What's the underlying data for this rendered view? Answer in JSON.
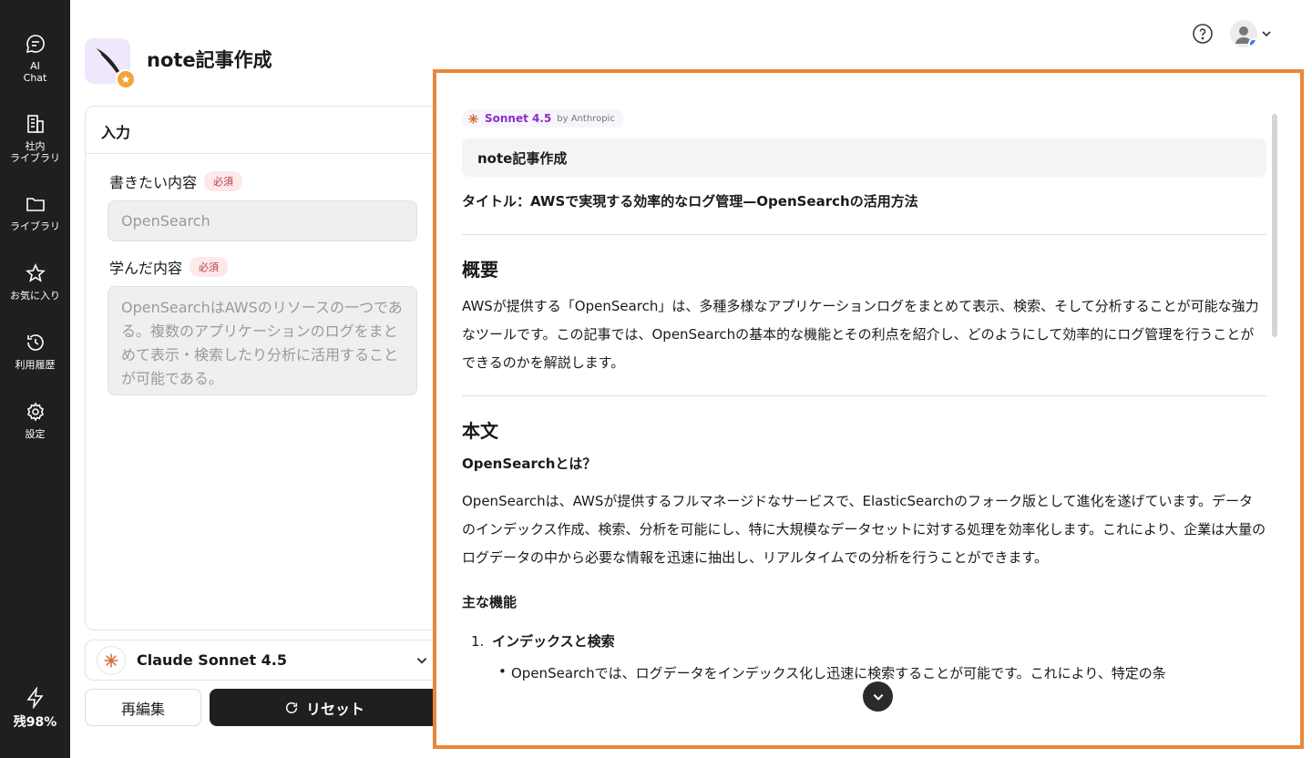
{
  "sidebar": {
    "items": [
      {
        "label": "AI\nChat",
        "icon": "chat-bubble-icon"
      },
      {
        "label": "社内\nライブラリ",
        "icon": "building-icon"
      },
      {
        "label": "ライブラリ",
        "icon": "folder-icon"
      },
      {
        "label": "お気に入り",
        "icon": "star-icon"
      },
      {
        "label": "利用履歴",
        "icon": "history-icon"
      },
      {
        "label": "設定",
        "icon": "gear-icon"
      }
    ],
    "remaining": "残98%"
  },
  "header": {
    "app_title": "note記事作成"
  },
  "input_panel": {
    "title": "入力",
    "fields": [
      {
        "label": "書きたい内容",
        "badge": "必須",
        "value": "OpenSearch"
      },
      {
        "label": "学んだ内容",
        "badge": "必須",
        "value": "OpenSearchはAWSのリソースの一つである。複数のアプリケーションのログをまとめて表示・検索したり分析に活用することが可能である。"
      }
    ],
    "model_name": "Claude Sonnet 4.5",
    "reedit_label": "再編集",
    "reset_label": "リセット"
  },
  "output": {
    "model_tag": "Sonnet 4.5",
    "model_by": "by Anthropic",
    "prompt_title": "note記事作成",
    "title_line": "タイトル：AWSで実現する効率的なログ管理—OpenSearchの活用方法",
    "section1_heading": "概要",
    "section1_text": "AWSが提供する「OpenSearch」は、多種多様なアプリケーションログをまとめて表示、検索、そして分析することが可能な強力なツールです。この記事では、OpenSearchの基本的な機能とその利点を紹介し、どのようにして効率的にログ管理を行うことができるのかを解説します。",
    "section2_heading": "本文",
    "sub_heading1": "OpenSearchとは？",
    "section2_text": "OpenSearchは、AWSが提供するフルマネージドなサービスで、ElasticSearchのフォーク版として進化を遂げています。データのインデックス作成、検索、分析を可能にし、特に大規模なデータセットに対する処理を効率化します。これにより、企業は大量のログデータの中から必要な情報を迅速に抽出し、リアルタイムでの分析を行うことができます。",
    "sub_heading2": "主な機能",
    "list_num": "1.",
    "list_item1": "インデックスと検索",
    "bullet1": "OpenSearchでは、ログデータをインデックス化し迅速に検索することが可能です。これにより、特定の条"
  },
  "colors": {
    "sidebar_bg": "#1f1f1f",
    "accent_orange": "#e8873a",
    "model_purple": "#8a2fc9",
    "required_red": "#b3404a"
  }
}
